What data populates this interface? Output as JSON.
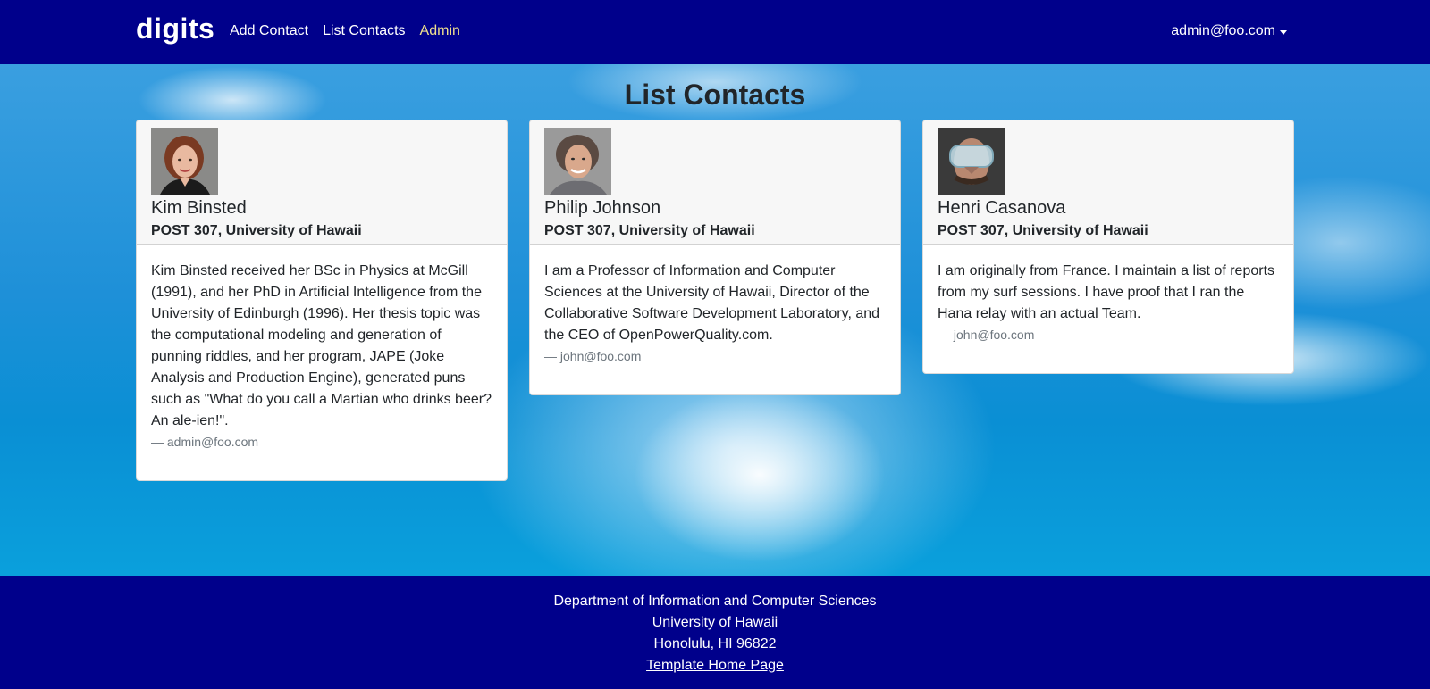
{
  "navbar": {
    "brand": "digits",
    "links": [
      {
        "label": "Add Contact"
      },
      {
        "label": "List Contacts"
      },
      {
        "label": "Admin"
      }
    ],
    "user": "admin@foo.com"
  },
  "page": {
    "title": "List Contacts"
  },
  "contacts": [
    {
      "name": "Kim Binsted",
      "address": "POST 307, University of Hawaii",
      "description": "Kim Binsted received her BSc in Physics at McGill (1991), and her PhD in Artificial Intelligence from the University of Edinburgh (1996). Her thesis topic was the computational modeling and generation of punning riddles, and her program, JAPE (Joke Analysis and Production Engine), generated puns such as \"What do you call a Martian who drinks beer? An ale-ien!\".",
      "owner": "— admin@foo.com"
    },
    {
      "name": "Philip Johnson",
      "address": "POST 307, University of Hawaii",
      "description": "I am a Professor of Information and Computer Sciences at the University of Hawaii, Director of the Collaborative Software Development Laboratory, and the CEO of OpenPowerQuality.com.",
      "owner": "— john@foo.com"
    },
    {
      "name": "Henri Casanova",
      "address": "POST 307, University of Hawaii",
      "description": "I am originally from France. I maintain a list of reports from my surf sessions. I have proof that I ran the Hana relay with an actual Team.",
      "owner": "— john@foo.com"
    }
  ],
  "footer": {
    "line1": "Department of Information and Computer Sciences",
    "line2": "University of Hawaii",
    "line3": "Honolulu, HI 96822",
    "link": "Template Home Page"
  },
  "colors": {
    "navbar": "#00008b",
    "admin_link": "#f0e08e",
    "footer": "#00008b"
  }
}
